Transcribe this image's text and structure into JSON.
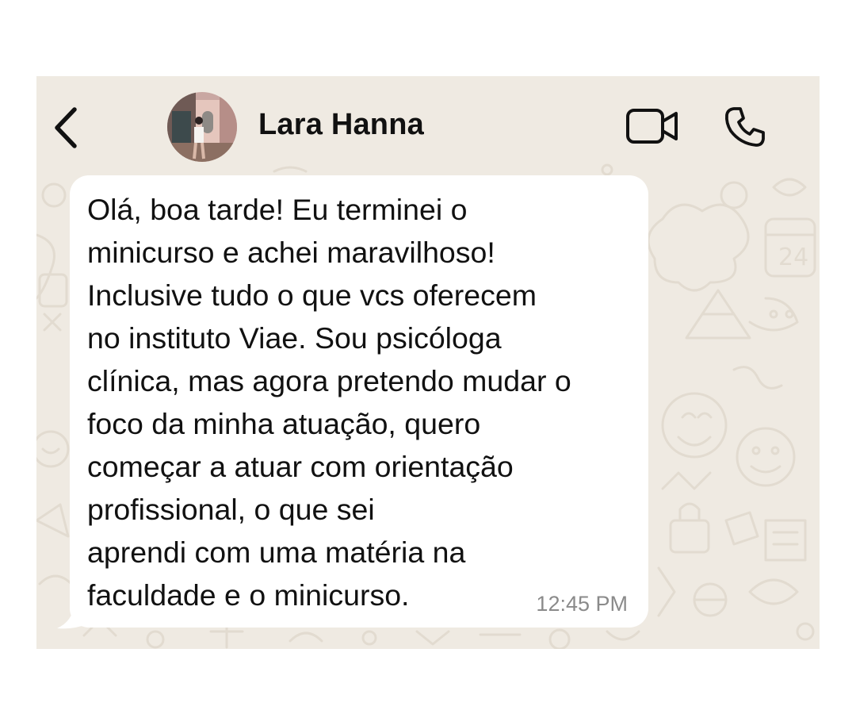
{
  "header": {
    "back_icon": "chevron-left-icon",
    "contact_name": "Lara Hanna",
    "video_icon": "video-camera-icon",
    "call_icon": "phone-icon"
  },
  "message": {
    "text": "Olá, boa tarde! Eu terminei o\nminicurso e achei maravilhoso!\nInclusive tudo o que vcs oferecem\nno instituto Viae. Sou psicóloga\nclínica, mas agora pretendo mudar o\nfoco da minha atuação, quero\ncomeçar a atuar com orientação\nprofissional, o que sei\naprendi com uma matéria na\nfaculdade e o minicurso.",
    "time": "12:45 PM",
    "direction": "incoming"
  },
  "colors": {
    "chat_background": "#efeae2",
    "bubble": "#ffffff",
    "text": "#111111",
    "timestamp": "#8a8a8a"
  }
}
